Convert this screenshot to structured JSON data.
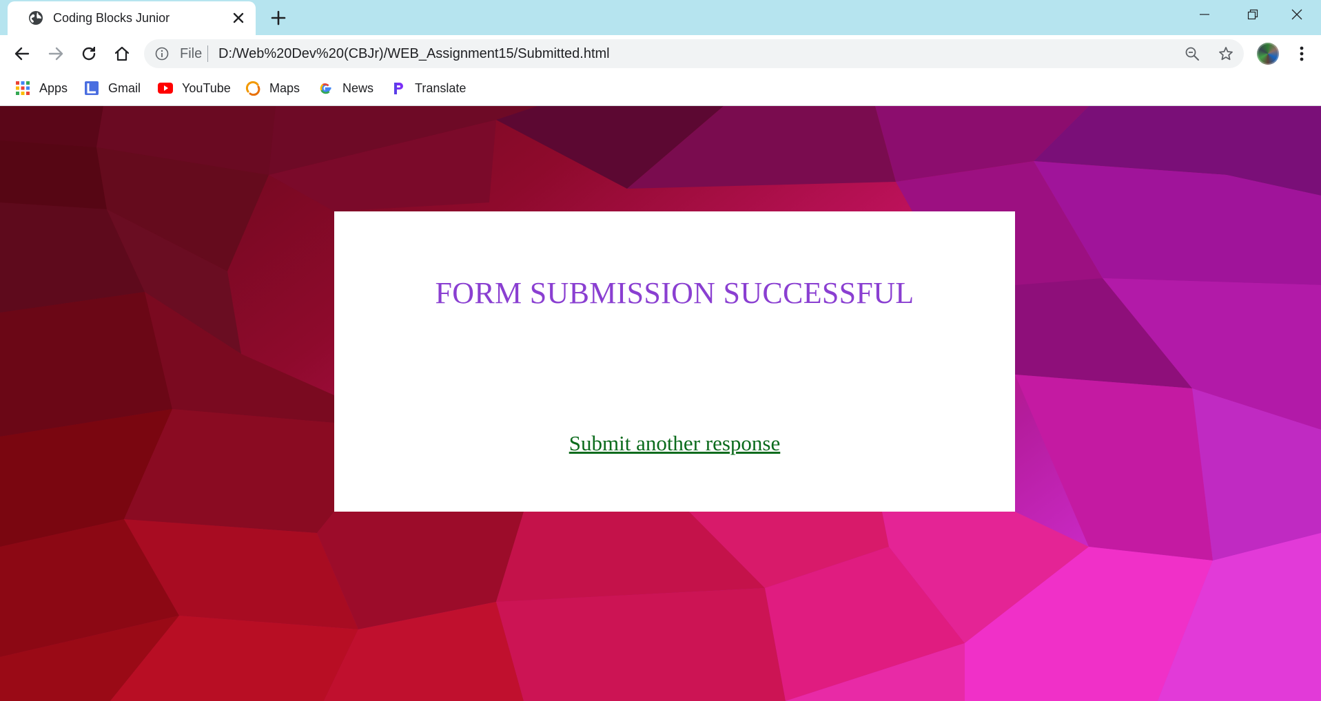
{
  "browser": {
    "tab": {
      "title": "Coding Blocks Junior",
      "favicon": "globe-icon"
    },
    "omnibox": {
      "scheme_label": "File",
      "url": "D:/Web%20Dev%20(CBJr)/WEB_Assignment15/Submitted.html"
    },
    "bookmarks": [
      {
        "label": "Apps",
        "icon": "apps-grid-icon"
      },
      {
        "label": "Gmail",
        "icon": "gmail-icon"
      },
      {
        "label": "YouTube",
        "icon": "youtube-icon"
      },
      {
        "label": "Maps",
        "icon": "maps-icon"
      },
      {
        "label": "News",
        "icon": "google-news-icon"
      },
      {
        "label": "Translate",
        "icon": "translate-icon"
      }
    ],
    "colors": {
      "tabstrip": "#b6e4ef",
      "omnibox": "#f1f3f4"
    }
  },
  "page": {
    "heading": "FORM SUBMISSION SUCCESSFUL",
    "link_text": "Submit another response",
    "colors": {
      "heading": "#8a3fd1",
      "link": "#0b6b1c",
      "card": "#ffffff",
      "background_from": "#6a0a12",
      "background_to": "#e033d6"
    }
  }
}
